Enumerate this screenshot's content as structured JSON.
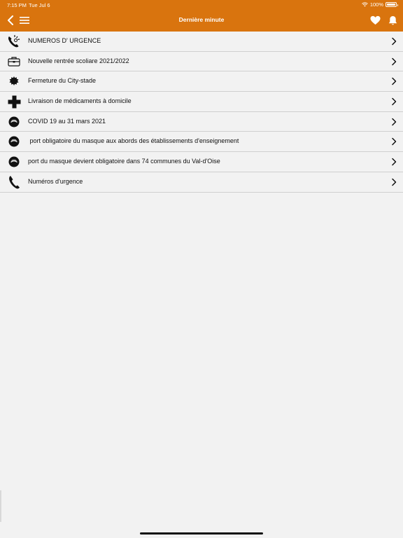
{
  "status_bar": {
    "time": "7:15 PM",
    "date": "Tue Jul 6",
    "battery": "100%"
  },
  "nav": {
    "title": "Dernière minute"
  },
  "items": [
    {
      "label": "NUMEROS D' URGENCE",
      "icon": "phone-alert-icon"
    },
    {
      "label": "Nouvelle rentrée scoliare 2021/2022",
      "icon": "school-bag-icon"
    },
    {
      "label": "Fermeture du City-stade",
      "icon": "badge-icon"
    },
    {
      "label": "Livraison de médicaments à domicile",
      "icon": "medical-cross-icon"
    },
    {
      "label": "COVID 19 au 31 mars 2021",
      "icon": "face-mask-icon"
    },
    {
      "label": " port obligatoire du masque aux abords des établissements d'enseignement",
      "icon": "face-mask-icon"
    },
    {
      "label": "port du masque devient obligatoire dans 74 communes du Val-d'Oise",
      "icon": "face-mask-icon"
    },
    {
      "label": "Numéros d'urgence",
      "icon": "phone-icon"
    }
  ],
  "colors": {
    "accent": "#d9740e",
    "background": "#f2f2f2",
    "divider": "#cfcfcf"
  }
}
